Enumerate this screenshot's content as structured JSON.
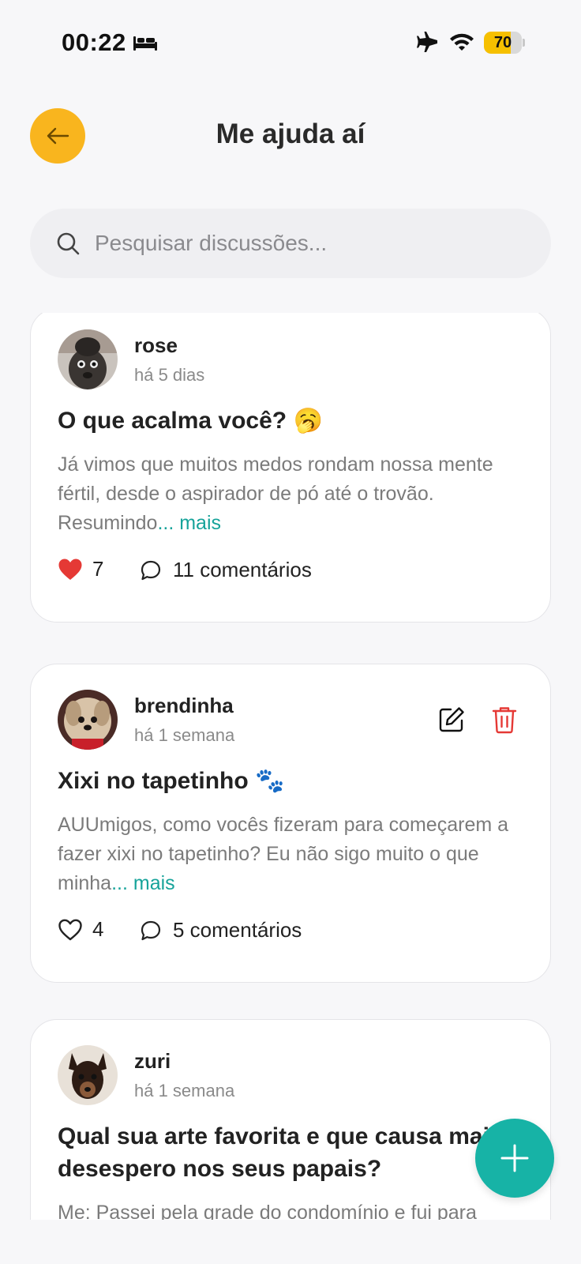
{
  "status_bar": {
    "time": "00:22",
    "battery_level": 70,
    "battery_label": "70",
    "icons": [
      "bed-icon",
      "airplane-icon",
      "wifi-icon",
      "battery-icon"
    ]
  },
  "header": {
    "title": "Me ajuda aí",
    "back_icon": "arrow-left-icon"
  },
  "search": {
    "placeholder": "Pesquisar discussões...",
    "value": ""
  },
  "posts": [
    {
      "username": "rose",
      "time_ago": "há 5 dias",
      "title": "O que acalma você? 🥱",
      "excerpt": "Já vimos que muitos medos rondam nossa mente fértil, desde o aspirador de pó até o trovão. Resumindo",
      "more_label": "... mais",
      "likes": "7",
      "liked": true,
      "comments_label": "11 comentários",
      "can_edit": false
    },
    {
      "username": "brendinha",
      "time_ago": "há 1 semana",
      "title": "Xixi no tapetinho 🐾",
      "excerpt": "AUUmigos, como vocês fizeram para começarem a fazer xixi no tapetinho? Eu não sigo muito o que minha",
      "more_label": "... mais",
      "likes": "4",
      "liked": false,
      "comments_label": "5 comentários",
      "can_edit": true
    },
    {
      "username": "zuri",
      "time_ago": "há 1 semana",
      "title": "Qual sua arte favorita e que causa mais desespero nos seus papais?",
      "excerpt": "Me: Passei pela grade do condomínio e fui para",
      "can_edit": false
    }
  ],
  "colors": {
    "accent_yellow": "#f9b51e",
    "teal": "#17b3a6",
    "link_teal": "#16a39a",
    "heart_red": "#e53935",
    "delete_red": "#e53935"
  }
}
